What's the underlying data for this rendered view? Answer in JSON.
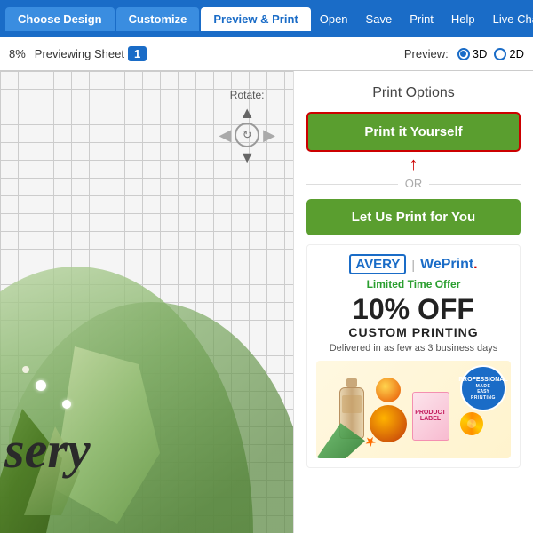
{
  "nav": {
    "tabs": [
      {
        "id": "choose-design",
        "label": "Choose Design",
        "active": false
      },
      {
        "id": "customize",
        "label": "Customize",
        "active": false
      },
      {
        "id": "preview-print",
        "label": "Preview & Print",
        "active": true
      }
    ],
    "links": [
      {
        "id": "open",
        "label": "Open"
      },
      {
        "id": "save",
        "label": "Save"
      },
      {
        "id": "print",
        "label": "Print"
      },
      {
        "id": "help",
        "label": "Help"
      },
      {
        "id": "live-chat",
        "label": "Live Chat"
      }
    ]
  },
  "toolbar": {
    "zoom_label": "8%",
    "previewing_label": "Previewing Sheet",
    "sheet_number": "1",
    "preview_label": "Preview:",
    "preview_3d": "3D",
    "preview_2d": "2D",
    "preview_selected": "3D"
  },
  "canvas": {
    "rotate_label": "Rotate:",
    "label_text": "sery"
  },
  "right_panel": {
    "print_options_title": "Print Options",
    "print_yourself_btn": "Print it Yourself",
    "or_text": "OR",
    "let_us_print_btn": "Let Us Print for You",
    "promo": {
      "avery_label": "AVERY",
      "weprint_label": "WePrint",
      "weprint_dot": ".",
      "limited_offer": "Limited Time Offer",
      "discount": "10% OFF",
      "custom_printing": "CUSTOM PRINTING",
      "delivery": "Delivered in as few as 3 business days",
      "badge_line1": "PROFESSIONAL",
      "badge_line2": "MADE",
      "badge_line3": "EASY",
      "badge_sub": "PRINTING"
    }
  }
}
